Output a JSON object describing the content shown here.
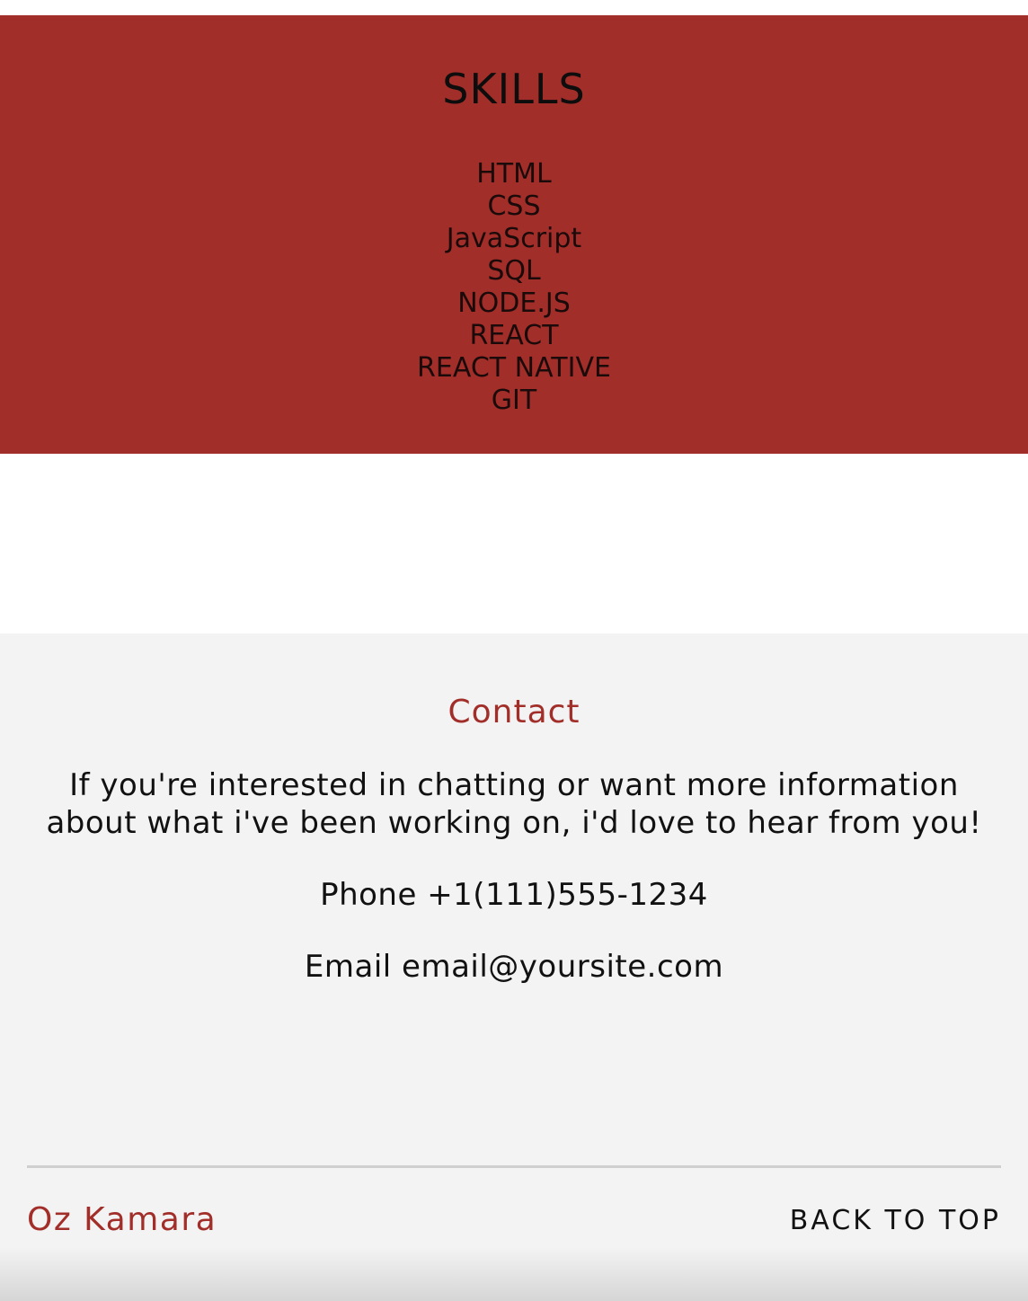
{
  "skills": {
    "title": "SKILLS",
    "items": [
      "HTML",
      "CSS",
      "JavaScript",
      "SQL",
      "NODE.JS",
      "REACT",
      "REACT NATIVE",
      "GIT"
    ],
    "background_color": "#a22e2a"
  },
  "contact": {
    "title": "Contact",
    "intro_line1": "If you're interested in chatting or want more information",
    "intro_line2": "about what i've been working on, i'd love to hear from you!",
    "phone": "Phone +1(111)555-1234",
    "email": "Email email@yoursite.com",
    "background_color": "#f3f3f3",
    "accent_color": "#a22e2a"
  },
  "footer": {
    "name": "Oz Kamara",
    "back_to_top": "BACK TO TOP"
  }
}
